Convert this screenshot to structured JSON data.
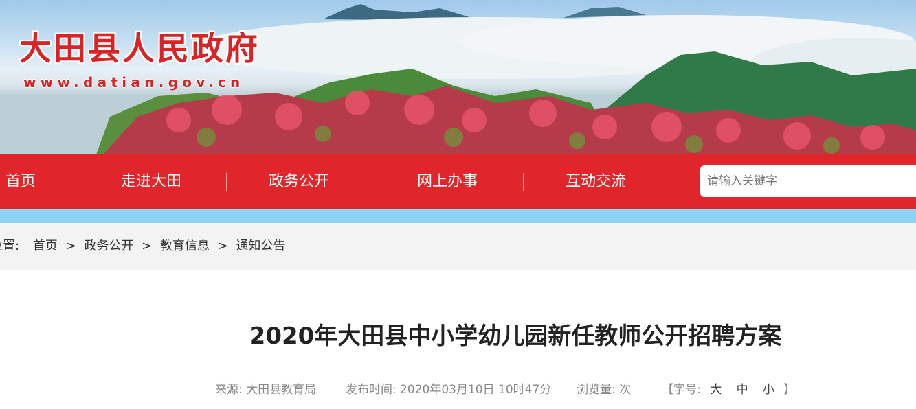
{
  "site": {
    "title": "大田县人民政府",
    "url": "www.datian.gov.cn"
  },
  "nav": {
    "items": [
      "首页",
      "走进大田",
      "政务公开",
      "网上办事",
      "互动交流"
    ],
    "search_placeholder": "请输入关键字"
  },
  "breadcrumb": {
    "lead": "位置:",
    "items": [
      "首页",
      "政务公开",
      "教育信息",
      "通知公告"
    ],
    "separator": ">"
  },
  "article": {
    "title": "2020年大田县中小学幼儿园新任教师公开招聘方案",
    "source": "来源: 大田县教育局",
    "published": "发布时间: 2020年03月10日 10时47分",
    "views": "浏览量: 次",
    "font_size": {
      "label": "【字号:",
      "large": "大",
      "medium": "中",
      "small": "小",
      "close": "】"
    }
  },
  "colors": {
    "nav_red": "#e0262a",
    "accent_blue": "#8ed3f6",
    "title_red": "#d92325"
  }
}
